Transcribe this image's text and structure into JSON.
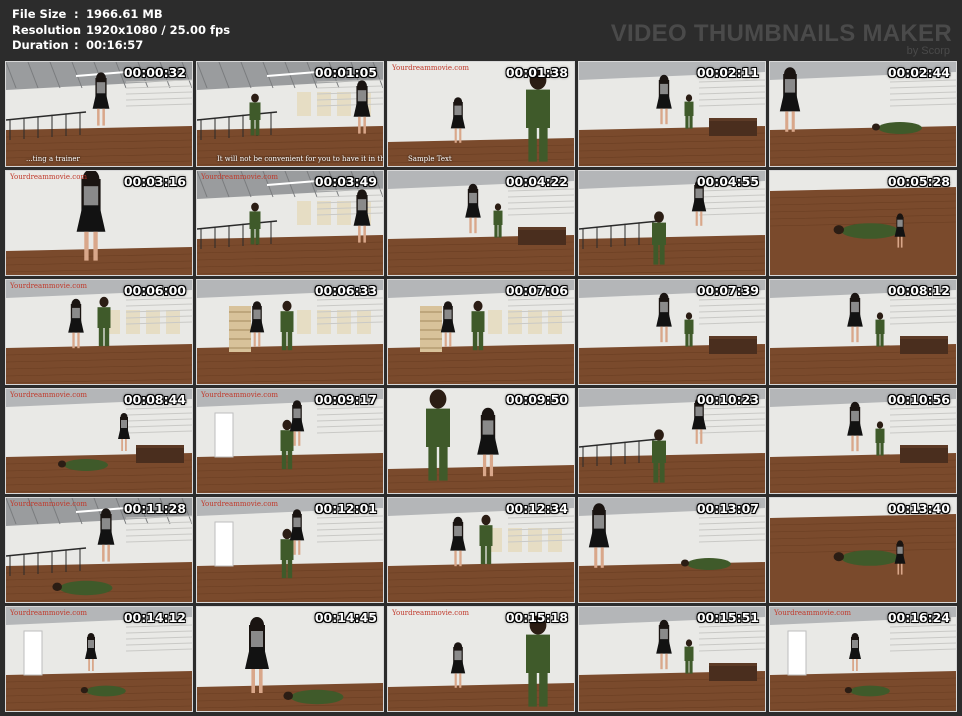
{
  "info": {
    "rows": [
      {
        "label": "File Size",
        "sep": ":",
        "value": "1966.61 MB"
      },
      {
        "label": "Resolution",
        "sep": ":",
        "value": "1920x1080 / 25.00 fps"
      },
      {
        "label": "Duration",
        "sep": ":",
        "value": "00:16:57"
      }
    ]
  },
  "watermark": {
    "title": "VIDEO THUMBNAILS MAKER",
    "subtitle": "by Scorp"
  },
  "site_text": "Yourdreammovie.com",
  "thumbnails": [
    {
      "time": "00:00:32",
      "scene": "loft-rail",
      "caption": "...ting a trainer",
      "site": false
    },
    {
      "time": "00:01:05",
      "scene": "loft-hall",
      "caption": "It will not be convenient for you to have it in this",
      "site": false
    },
    {
      "time": "00:01:38",
      "scene": "closeup-wall",
      "caption": "Sample Text",
      "site": true
    },
    {
      "time": "00:02:11",
      "scene": "room-desk",
      "caption": "",
      "site": false
    },
    {
      "time": "00:02:44",
      "scene": "room-floor",
      "caption": "",
      "site": false
    },
    {
      "time": "00:03:16",
      "scene": "closeup-hair",
      "caption": "",
      "site": true
    },
    {
      "time": "00:03:49",
      "scene": "loft-hall",
      "caption": "",
      "site": true
    },
    {
      "time": "00:04:22",
      "scene": "room-desk",
      "caption": "",
      "site": false
    },
    {
      "time": "00:04:55",
      "scene": "room-rail",
      "caption": "",
      "site": false
    },
    {
      "time": "00:05:28",
      "scene": "floor-close",
      "caption": "",
      "site": false
    },
    {
      "time": "00:06:00",
      "scene": "room-panels",
      "caption": "",
      "site": true
    },
    {
      "time": "00:06:33",
      "scene": "room-shelf",
      "caption": "",
      "site": false
    },
    {
      "time": "00:07:06",
      "scene": "room-shelf",
      "caption": "",
      "site": false
    },
    {
      "time": "00:07:39",
      "scene": "room-desk",
      "caption": "",
      "site": false
    },
    {
      "time": "00:08:12",
      "scene": "room-desk",
      "caption": "",
      "site": false
    },
    {
      "time": "00:08:44",
      "scene": "room-desk-floor",
      "caption": "",
      "site": true
    },
    {
      "time": "00:09:17",
      "scene": "room-door",
      "caption": "",
      "site": true
    },
    {
      "time": "00:09:50",
      "scene": "closeup-two",
      "caption": "",
      "site": false
    },
    {
      "time": "00:10:23",
      "scene": "room-rail",
      "caption": "",
      "site": false
    },
    {
      "time": "00:10:56",
      "scene": "room-desk",
      "caption": "",
      "site": false
    },
    {
      "time": "00:11:28",
      "scene": "loft-floor",
      "caption": "",
      "site": true
    },
    {
      "time": "00:12:01",
      "scene": "room-door",
      "caption": "",
      "site": true
    },
    {
      "time": "00:12:34",
      "scene": "room-panels",
      "caption": "",
      "site": false
    },
    {
      "time": "00:13:07",
      "scene": "room-floor",
      "caption": "",
      "site": false
    },
    {
      "time": "00:13:40",
      "scene": "floor-close",
      "caption": "",
      "site": false
    },
    {
      "time": "00:14:12",
      "scene": "room-door-floor",
      "caption": "",
      "site": true
    },
    {
      "time": "00:14:45",
      "scene": "closeup-floor",
      "caption": "",
      "site": false
    },
    {
      "time": "00:15:18",
      "scene": "closeup-wall",
      "caption": "",
      "site": true
    },
    {
      "time": "00:15:51",
      "scene": "room-desk",
      "caption": "",
      "site": false
    },
    {
      "time": "00:16:24",
      "scene": "room-door-floor",
      "caption": "",
      "site": true
    }
  ],
  "colors": {
    "background": "#2c2c2c",
    "wall": "#e9e9e6",
    "floor": "#7a4a2c",
    "uniform": "#3f5a2a",
    "skirt": "#121212",
    "skin": "#d9a78a"
  }
}
